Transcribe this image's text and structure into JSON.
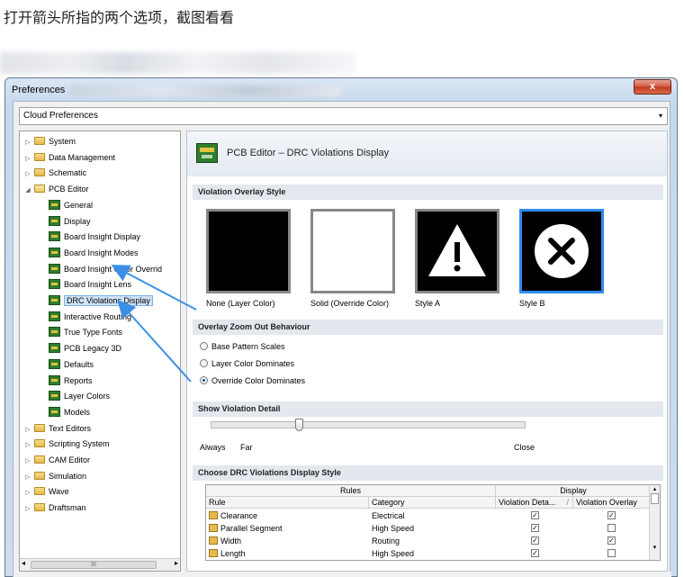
{
  "post": {
    "text": "打开箭头所指的两个选项，截图看看"
  },
  "window": {
    "title": "Preferences",
    "close_glyph": "x"
  },
  "cloud_combo": {
    "value": "Cloud Preferences",
    "arrow": "▾"
  },
  "tree": {
    "items": [
      {
        "label": "System",
        "expander": "▷",
        "icon": "folder-icon",
        "level": 0
      },
      {
        "label": "Data Management",
        "expander": "▷",
        "icon": "folder-icon",
        "level": 0
      },
      {
        "label": "Schematic",
        "expander": "▷",
        "icon": "folder-icon",
        "level": 0
      },
      {
        "label": "PCB Editor",
        "expander": "◢",
        "icon": "folder-open-icon",
        "level": 0
      },
      {
        "label": "General",
        "icon": "pcb-icon",
        "level": 1
      },
      {
        "label": "Display",
        "icon": "pcb-icon",
        "level": 1
      },
      {
        "label": "Board Insight Display",
        "icon": "pcb-icon",
        "level": 1
      },
      {
        "label": "Board Insight Modes",
        "icon": "pcb-icon",
        "level": 1
      },
      {
        "label": "Board Insight Color Overrid",
        "icon": "pcb-icon",
        "level": 1
      },
      {
        "label": "Board Insight Lens",
        "icon": "pcb-icon",
        "level": 1
      },
      {
        "label": "DRC Violations Display",
        "icon": "pcb-icon",
        "level": 1,
        "selected": true
      },
      {
        "label": "Interactive Routing",
        "icon": "pcb-icon",
        "level": 1
      },
      {
        "label": "True Type Fonts",
        "icon": "pcb-icon",
        "level": 1
      },
      {
        "label": "PCB Legacy 3D",
        "icon": "pcb-icon",
        "level": 1
      },
      {
        "label": "Defaults",
        "icon": "pcb-icon",
        "level": 1
      },
      {
        "label": "Reports",
        "icon": "pcb-icon",
        "level": 1
      },
      {
        "label": "Layer Colors",
        "icon": "pcb-icon",
        "level": 1
      },
      {
        "label": "Models",
        "icon": "pcb-icon",
        "level": 1
      },
      {
        "label": "Text Editors",
        "expander": "▷",
        "icon": "folder-icon",
        "level": 0
      },
      {
        "label": "Scripting System",
        "expander": "▷",
        "icon": "folder-icon",
        "level": 0
      },
      {
        "label": "CAM Editor",
        "expander": "▷",
        "icon": "folder-icon",
        "level": 0
      },
      {
        "label": "Simulation",
        "expander": "▷",
        "icon": "folder-icon",
        "level": 0
      },
      {
        "label": "Wave",
        "expander": "▷",
        "icon": "folder-icon",
        "level": 0
      },
      {
        "label": "Draftsman",
        "expander": "▷",
        "icon": "folder-icon",
        "level": 0
      }
    ],
    "scroll": {
      "left": "◂",
      "right": "▸",
      "grip": "III"
    }
  },
  "panel": {
    "title": "PCB Editor – DRC Violations Display",
    "overlay_style": {
      "heading": "Violation Overlay Style",
      "options": [
        {
          "label": "None (Layer Color)",
          "style": "none"
        },
        {
          "label": "Solid (Override Color)",
          "style": "solid"
        },
        {
          "label": "Style A",
          "style": "a"
        },
        {
          "label": "Style B",
          "style": "b",
          "selected": true
        }
      ]
    },
    "zoom_out": {
      "heading": "Overlay Zoom Out Behaviour",
      "options": [
        {
          "label": "Base Pattern Scales",
          "checked": false
        },
        {
          "label": "Layer Color Dominates",
          "checked": false
        },
        {
          "label": "Override Color Dominates",
          "checked": true
        }
      ]
    },
    "detail": {
      "heading": "Show Violation Detail",
      "left_label": "Always",
      "far_label": "Far",
      "right_label": "Close",
      "level": 0.28
    },
    "display_style": {
      "heading": "Choose DRC Violations Display Style",
      "group_rules": "Rules",
      "group_display": "Display",
      "columns": [
        "Rule",
        "Category",
        "Violation Deta...",
        "Violation Overlay"
      ],
      "sort_mark": "/",
      "rows": [
        {
          "rule": "Clearance",
          "category": "Electrical",
          "detail": true,
          "overlay": true
        },
        {
          "rule": "Parallel Segment",
          "category": "High Speed",
          "detail": true,
          "overlay": false
        },
        {
          "rule": "Width",
          "category": "Routing",
          "detail": true,
          "overlay": true
        },
        {
          "rule": "Length",
          "category": "High Speed",
          "detail": true,
          "overlay": false
        }
      ],
      "scroll_up": "▴",
      "scroll_down": "▾"
    }
  },
  "colors": {
    "accent_blue": "#2d8bf0",
    "arrow_blue": "#3b8fe6",
    "section_bg": "#e3e8ee"
  }
}
